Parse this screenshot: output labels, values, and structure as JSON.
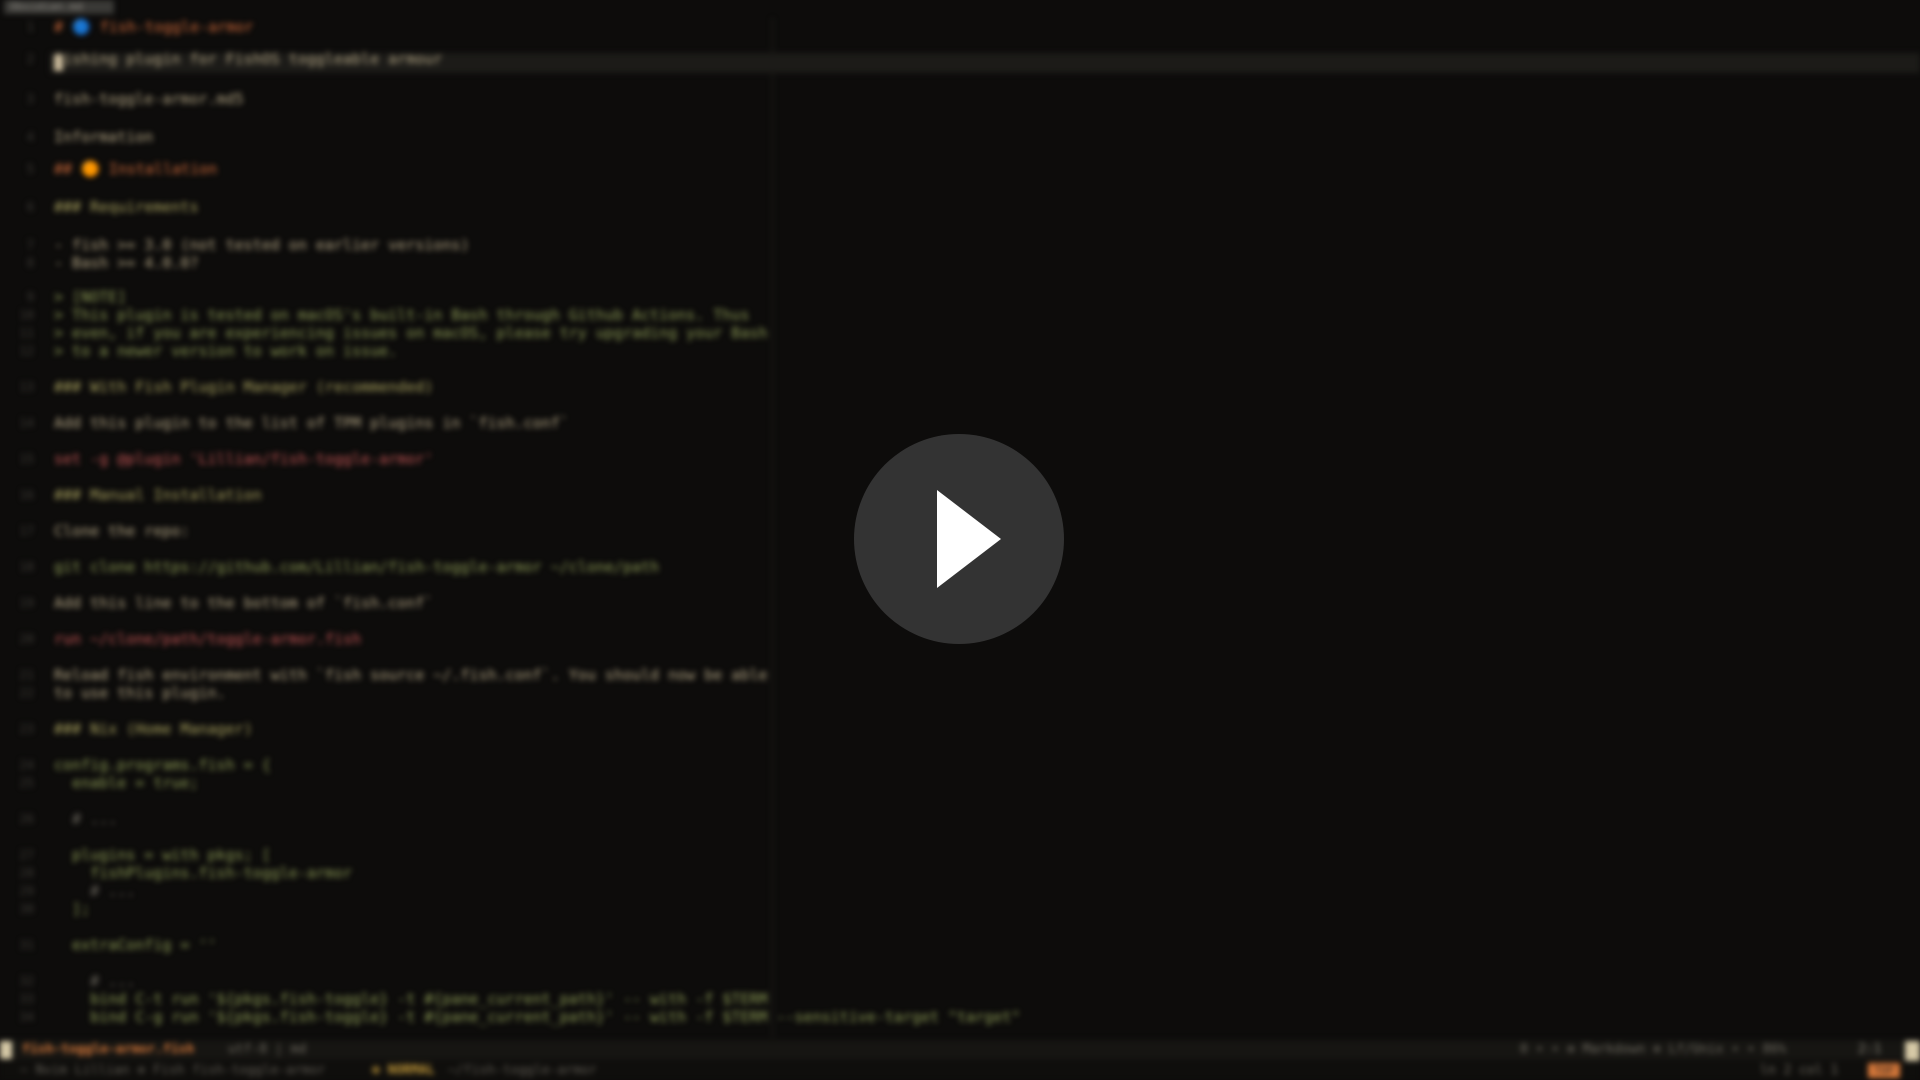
{
  "window": {
    "top_tab": "Obsidian.md"
  },
  "editor": {
    "lines": [
      {
        "n": "1",
        "cls": "c-head1",
        "badge": "blue",
        "text": "# 🔵 fish-toggle-armor"
      },
      {
        "n": "2",
        "cls": "c-text",
        "badge": "",
        "text": "Fishing plugin for FishOS toggleable armour"
      },
      {
        "n": "3",
        "cls": "c-text",
        "badge": "",
        "text": "fish-toggle-armor.md5"
      },
      {
        "n": "4",
        "cls": "c-text",
        "badge": "",
        "text": "Information"
      },
      {
        "n": "5",
        "cls": "c-head1",
        "badge": "orange",
        "text": "## 🟠 Installation"
      },
      {
        "n": "6",
        "cls": "c-head2",
        "badge": "",
        "text": "### Requirements"
      },
      {
        "n": "7",
        "cls": "c-text",
        "badge": "",
        "text": "- fish >= 3.0 (not tested on earlier versions)"
      },
      {
        "n": "8",
        "cls": "c-text",
        "badge": "",
        "text": "- Bash >= 4.0.0?"
      },
      {
        "n": "9",
        "cls": "c-green",
        "badge": "",
        "text": "> [NOTE]"
      },
      {
        "n": "10",
        "cls": "c-green",
        "badge": "",
        "text": "> This plugin is tested on macOS's built-in Bash through Github Actions. Thus"
      },
      {
        "n": "11",
        "cls": "c-green",
        "badge": "",
        "text": "> even, if you are experiencing issues on macOS, please try upgrading your Bash"
      },
      {
        "n": "12",
        "cls": "c-green",
        "badge": "",
        "text": "> to a newer version to work on issue."
      },
      {
        "n": "13",
        "cls": "c-head2",
        "badge": "",
        "text": "### With Fish Plugin Manager (recommended)"
      },
      {
        "n": "14",
        "cls": "c-text",
        "badge": "",
        "text": "Add this plugin to the list of TPM plugins in `fish.conf`"
      },
      {
        "n": "15",
        "cls": "c-red",
        "badge": "",
        "text": "set -g @plugin 'Lillian/fish-toggle-armor'"
      },
      {
        "n": "16",
        "cls": "c-head2",
        "badge": "",
        "text": "### Manual Installation"
      },
      {
        "n": "17",
        "cls": "c-text",
        "badge": "",
        "text": "Clone the repo:"
      },
      {
        "n": "18",
        "cls": "c-green",
        "badge": "",
        "text": "git clone https://github.com/Lillian/fish-toggle-armor ~/clone/path"
      },
      {
        "n": "19",
        "cls": "c-text",
        "badge": "",
        "text": "Add this line to the bottom of `fish.conf`"
      },
      {
        "n": "20",
        "cls": "c-red",
        "badge": "",
        "text": "run ~/clone/path/toggle-armor.fish"
      },
      {
        "n": "21",
        "cls": "c-text",
        "badge": "",
        "text": "Reload fish environment with `fish source ~/.fish.conf`. You should now be able"
      },
      {
        "n": "22",
        "cls": "c-text",
        "badge": "",
        "text": "to use this plugin."
      },
      {
        "n": "23",
        "cls": "c-head2",
        "badge": "",
        "text": "### Nix (Home Manager)"
      },
      {
        "n": "24",
        "cls": "c-green",
        "badge": "",
        "text": "config.programs.fish = {"
      },
      {
        "n": "25",
        "cls": "c-green",
        "badge": "",
        "text": "  enable = true;"
      },
      {
        "n": "26",
        "cls": "c-dim",
        "badge": "",
        "text": "  # ..."
      },
      {
        "n": "27",
        "cls": "c-green",
        "badge": "",
        "text": "  plugins = with pkgs; ["
      },
      {
        "n": "28",
        "cls": "c-green",
        "badge": "",
        "text": "    fishPlugins.fish-toggle-armor"
      },
      {
        "n": "29",
        "cls": "c-dim",
        "badge": "",
        "text": "    # ..."
      },
      {
        "n": "30",
        "cls": "c-green",
        "badge": "",
        "text": "  ];"
      },
      {
        "n": "31",
        "cls": "c-green",
        "badge": "",
        "text": "  extraConfig = ''"
      },
      {
        "n": "32",
        "cls": "c-dim",
        "badge": "",
        "text": "    # ..."
      },
      {
        "n": "33",
        "cls": "c-green",
        "badge": "",
        "text": "    bind C-t run '${pkgs.fish-toggle} -t #{pane_current_path}' -- with -f $TERM"
      },
      {
        "n": "34",
        "cls": "c-green",
        "badge": "",
        "text": "    bind C-g run '${pkgs.fish-toggle} -t #{pane_current_path}' -- with -f $TERM --sensitive-target \"target\""
      }
    ]
  },
  "statusbar": {
    "file": "fish-toggle-armor.fish",
    "format": "utf-8 | md",
    "right": "0 ∙ ∙ ⊕ Markdown  ⊗ Lf/Unix  ∙ ∙ 86%",
    "position": "2:1"
  },
  "cmdline": {
    "left": "~  Nvim  Lillian  ⊕  Fish  fish-toggle-armor",
    "mode": "⊗ NORMAL",
    "mode_detail": "~/fish-toggle-armor",
    "right": "ln 2  col 1",
    "pill": "TOP"
  },
  "overlay": {
    "play_button_label": "Play video"
  }
}
